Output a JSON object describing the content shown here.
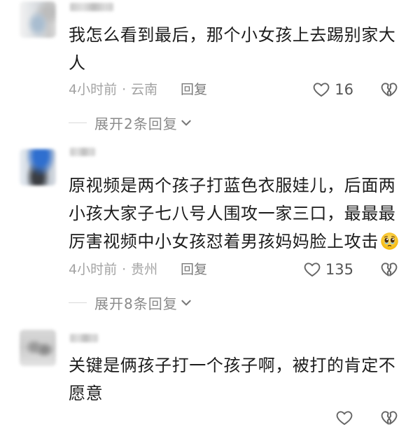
{
  "comments": [
    {
      "text_lines": [
        "我怎么看到最后，那个小女孩上去踢别家大",
        "人"
      ],
      "time": "4小时前",
      "separator": "·",
      "location": "云南",
      "reply_label": "回复",
      "likes": "16",
      "expand_label": "展开2条回复"
    },
    {
      "text_lines": [
        "原视频是两个孩子打蓝色衣服娃儿，后面两",
        "小孩大家子七八号人围攻一家三口，最最最",
        "厉害视频中小女孩怼着男孩妈妈脸上攻击"
      ],
      "emoji": "face-holding-back-tears",
      "time": "4小时前",
      "separator": "·",
      "location": "贵州",
      "reply_label": "回复",
      "likes": "135",
      "expand_label": "展开8条回复"
    },
    {
      "text_lines": [
        "关键是俩孩子打一个孩子啊，被打的肯定不",
        "愿意"
      ]
    }
  ],
  "icons": {
    "like": "heart-outline-icon",
    "dislike": "broken-heart-icon",
    "expand": "chevron-down-icon"
  },
  "colors": {
    "body_text": "#1c1c1c",
    "meta_text": "#a3a3a3",
    "icon_stroke": "#666666"
  }
}
